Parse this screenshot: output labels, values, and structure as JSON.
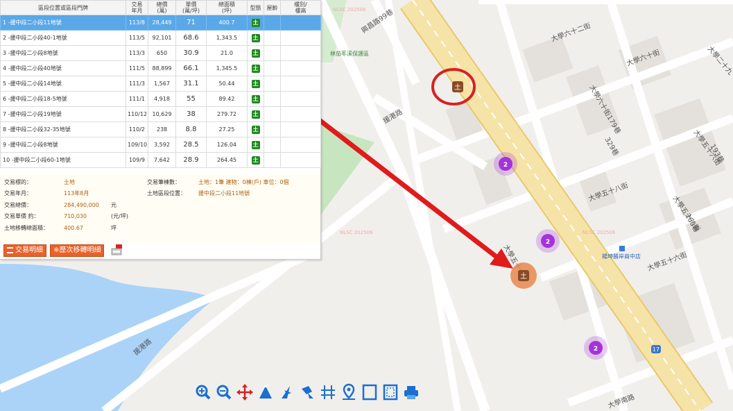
{
  "table": {
    "headers": [
      "區段位置或區段門牌",
      "交易\n年月",
      "總價\n(萬)",
      "單價\n(萬/坪)",
      "總面積\n(坪)",
      "型態",
      "屋齡",
      "樓別/\n樓高"
    ],
    "rows": [
      {
        "addr": "1 -援中段二小段11地號",
        "ym": "113/8",
        "total": "28,449",
        "unit": "71",
        "area": "400.7",
        "type": "土",
        "selected": true
      },
      {
        "addr": "2 -援中段二小段40-1地號",
        "ym": "113/5",
        "total": "92,101",
        "unit": "68.6",
        "area": "1,343.5",
        "type": "土"
      },
      {
        "addr": "3 -援中段二小段8地號",
        "ym": "113/3",
        "total": "650",
        "unit": "30.9",
        "area": "21.0",
        "type": "土"
      },
      {
        "addr": "4 -援中段二小段40地號",
        "ym": "111/5",
        "total": "88,899",
        "unit": "66.1",
        "area": "1,345.5",
        "type": "土"
      },
      {
        "addr": "5 -援中段二小段14地號",
        "ym": "111/3",
        "total": "1,567",
        "unit": "31.1",
        "area": "50.44",
        "type": "土"
      },
      {
        "addr": "6 -援中段二小段18-5地號",
        "ym": "111/1",
        "total": "4,918",
        "unit": "55",
        "area": "89.42",
        "type": "土"
      },
      {
        "addr": "7 -援中段二小段19地號",
        "ym": "110/12",
        "total": "10,629",
        "unit": "38",
        "area": "279.72",
        "type": "土"
      },
      {
        "addr": "8 -援中段二小段32-35地號",
        "ym": "110/2",
        "total": "238",
        "unit": "8.8",
        "area": "27.25",
        "type": "土"
      },
      {
        "addr": "9 -援中段二小段8地號",
        "ym": "109/10",
        "total": "3,592",
        "unit": "28.5",
        "area": "126.04",
        "type": "土"
      },
      {
        "addr": "10 -援中段二小段60-1地號",
        "ym": "109/9",
        "total": "7,642",
        "unit": "28.9",
        "area": "264.45",
        "type": "土"
      }
    ]
  },
  "details": {
    "target_label": "交易標的：",
    "target_value": "土地",
    "ym_label": "交易年月：",
    "ym_value": "113年8月",
    "total_label": "交易總價：",
    "total_value": "284,490,000",
    "total_unit": "元",
    "unit_label": "交易單價 約：",
    "unit_value": "710,030",
    "unit_unit": "(元/坪)",
    "area_label": "土地移轉總面積：",
    "area_value": "400.67",
    "area_unit": "坪",
    "count_label": "交易筆棟數：",
    "count_value": "土地：1筆 建物：0棟(戶) 車位：0個",
    "loc_label": "土地區段位置：",
    "loc_value": "援中段二小段11地號"
  },
  "buttons": {
    "detail": "交易明細",
    "history": "※歷次移轉明細"
  },
  "map": {
    "street_labels": [
      "興昌路99巷",
      "大學六十二街",
      "大學六十街",
      "大學二十九",
      "大學六十街179巷",
      "大學五十八街",
      "大學五十六街",
      "援港路",
      "大學五十八街",
      "大學五十六街",
      "大學南路",
      "大學五十六街",
      "援港路"
    ],
    "alley_labels": [
      "329巷",
      "193巷",
      "260巷"
    ],
    "poi_labels": [
      "林茄苳溪保護區",
      "楊坤勝岸商中店"
    ],
    "nlsc_labels": [
      "NLSC 202506",
      "NLSC 202506",
      "NLSC 202506"
    ],
    "marker_text": "土",
    "cluster_counts": [
      "2",
      "2",
      "2"
    ],
    "route_shield": "17",
    "colors": {
      "major_road": "#f6e3a7",
      "road_edge": "#e8c96a",
      "water": "#aad3f7",
      "green": "#c7e6c0",
      "highlight_ring": "#d62222",
      "arrow": "#e01b1b",
      "cluster": "#a433d8"
    }
  },
  "tools": [
    "zoom-in-icon",
    "zoom-out-icon",
    "pan-icon",
    "measure-area-icon",
    "select-icon",
    "select-polygon-icon",
    "grid-icon",
    "location-pin-icon",
    "frame-icon",
    "frame-dashed-icon",
    "printer-icon"
  ]
}
